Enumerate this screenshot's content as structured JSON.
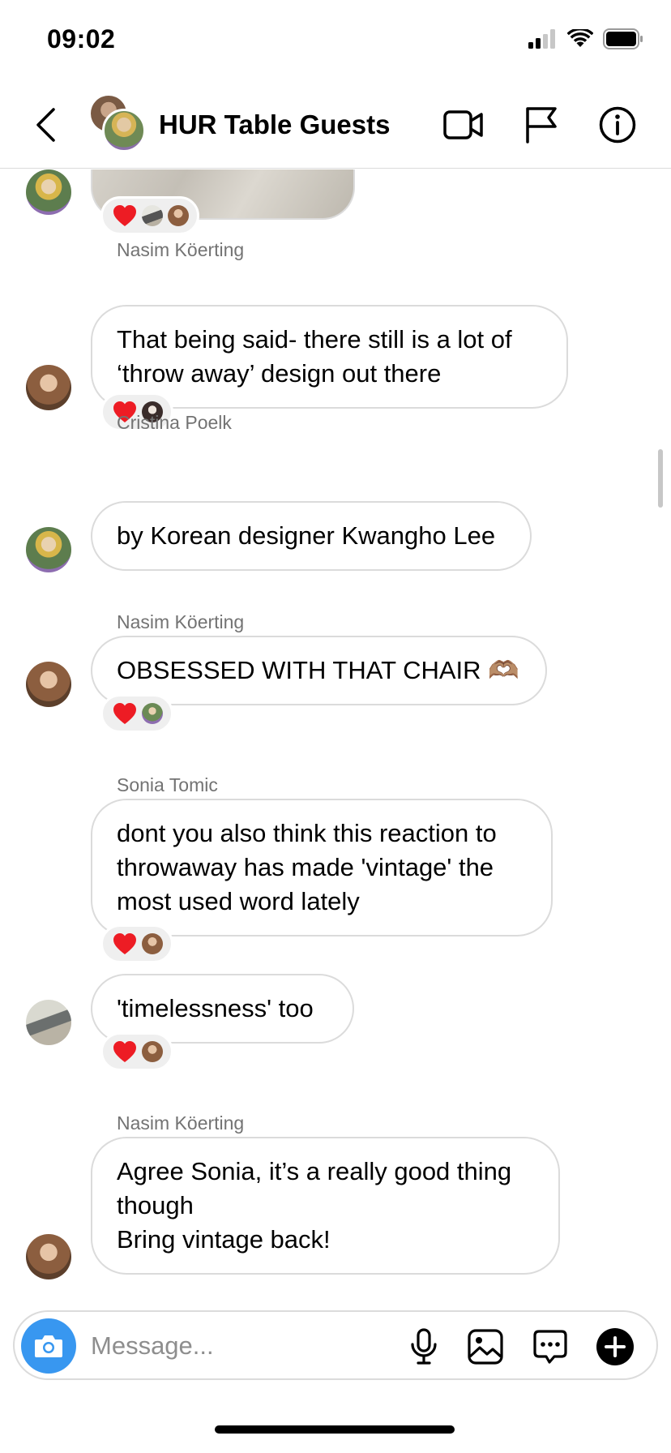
{
  "status_bar": {
    "time": "09:02",
    "icons": [
      "cellular-signal-icon",
      "wifi-icon",
      "battery-icon"
    ]
  },
  "header": {
    "title": "HUR Table Guests",
    "actions": [
      "video-call-icon",
      "flag-icon",
      "info-icon"
    ]
  },
  "messages": [
    {
      "type": "image",
      "sender": "",
      "reactions": {
        "emoji": "❤️",
        "count_avatars": 2
      }
    },
    {
      "type": "text",
      "sender": "Nasim Köerting",
      "text": "That being said- there still is a lot of\n‘throw away’ design out there",
      "reactions": {
        "emoji": "❤️",
        "count_avatars": 1
      }
    },
    {
      "type": "text",
      "sender": "Cristina Poelk",
      "text": "by Korean designer Kwangho Lee"
    },
    {
      "type": "text",
      "sender": "Nasim Köerting",
      "text": "OBSESSED WITH THAT CHAIR 🫶🏽",
      "reactions": {
        "emoji": "❤️",
        "count_avatars": 1
      }
    },
    {
      "type": "text",
      "sender": "Sonia Tomic",
      "text": "dont you also think this reaction to\nthrowaway has made 'vintage' the\nmost used word lately",
      "reactions": {
        "emoji": "❤️",
        "count_avatars": 1
      }
    },
    {
      "type": "text",
      "sender": "",
      "text": "'timelessness' too",
      "reactions": {
        "emoji": "❤️",
        "count_avatars": 1
      }
    },
    {
      "type": "text",
      "sender": "Nasim Köerting",
      "text": "Agree Sonia, it’s a really good thing\nthough\nBring vintage back!"
    }
  ],
  "composer": {
    "placeholder": "Message...",
    "value": "",
    "icons": [
      "camera-icon",
      "microphone-icon",
      "gallery-icon",
      "sticker-icon",
      "plus-icon"
    ]
  },
  "colors": {
    "accent": "#3897f0",
    "bubble_border": "#dbdbdb",
    "sender_text": "#737373",
    "reaction_bg": "#efefef",
    "heart": "#ed1c24"
  }
}
